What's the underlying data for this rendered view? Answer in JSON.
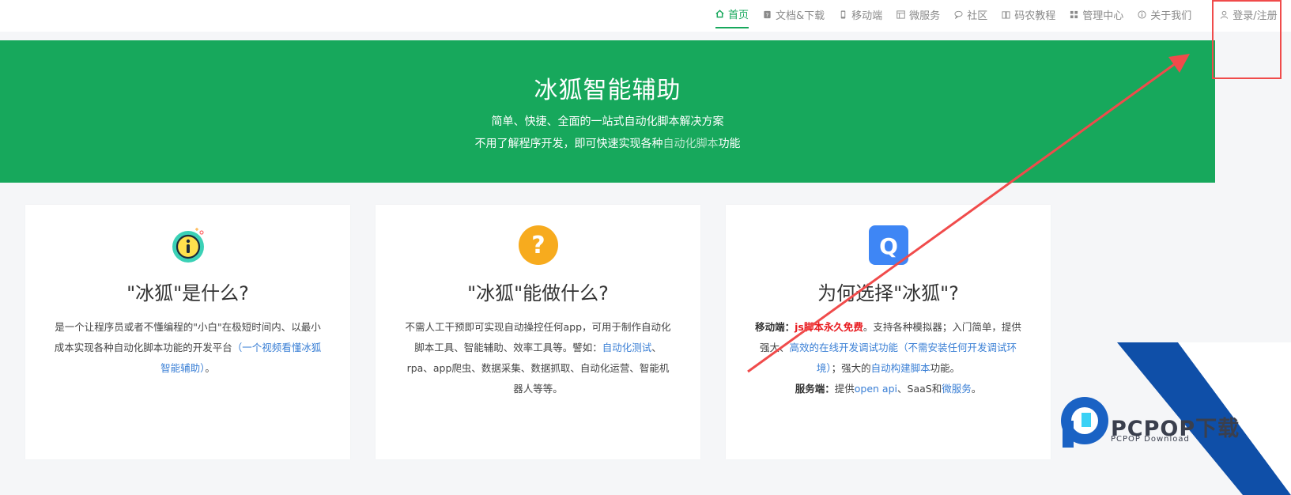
{
  "nav": {
    "items": [
      {
        "label": "首页",
        "icon": "home-icon",
        "active": true
      },
      {
        "label": "文档&下载",
        "icon": "document-icon"
      },
      {
        "label": "移动端",
        "icon": "mobile-icon"
      },
      {
        "label": "微服务",
        "icon": "server-icon"
      },
      {
        "label": "社区",
        "icon": "chat-icon"
      },
      {
        "label": "码农教程",
        "icon": "book-icon"
      },
      {
        "label": "管理中心",
        "icon": "grid-icon"
      },
      {
        "label": "关于我们",
        "icon": "info-icon"
      }
    ],
    "login_label": "登录/注册"
  },
  "hero": {
    "title": "冰狐智能辅助",
    "subtitle1": "简单、快捷、全面的一站式自动化脚本解决方案",
    "subtitle2_prefix": "不用了解程序开发，即可快速实现各种",
    "subtitle2_highlight": "自动化脚本",
    "subtitle2_suffix": "功能"
  },
  "cards": [
    {
      "icon": "info-circle-icon",
      "title": "\"冰狐\"是什么?",
      "desc_part1": "是一个让程序员或者不懂编程的\"小白\"在极短时间内、以最小成本实现各种自动化脚本功能的开发平台",
      "desc_link": "（一个视频看懂冰狐智能辅助）",
      "desc_end": "。"
    },
    {
      "icon": "question-circle-icon",
      "title": "\"冰狐\"能做什么?",
      "desc_part1": "不需人工干预即可实现自动操控任何app，可用于制作自动化脚本工具、智能辅助、效率工具等。譬如：",
      "desc_link": "自动化测试",
      "desc_part2": "、rpa、app爬虫、数据采集、数据抓取、自动化运营、智能机器人等等。"
    },
    {
      "icon": "q-logo-icon",
      "title": "为何选择\"冰狐\"?",
      "mobile_label": "移动端：",
      "mobile_free": "js脚本永久免费",
      "mobile_text1": "。支持各种模拟器；入门简单，提供强大、",
      "mobile_link1": "高效的在线开发调试功能（不需安装任何开发调试环境）",
      "mobile_text2": "；强大的",
      "mobile_link2": "自动构建脚本",
      "mobile_text3": "功能。",
      "server_label": "服务端：",
      "server_text1": "提供",
      "server_link1": "open api",
      "server_text2": "、SaaS和",
      "server_link2": "微服务",
      "server_text3": "。"
    }
  ],
  "watermark": {
    "brand": "PCPOP下载",
    "sub": "PCPOP Download"
  },
  "colors": {
    "brand_green": "#17a85c",
    "link_blue": "#3a7fd5",
    "highlight_red": "#e8191e",
    "annotation_red": "#f04b4b",
    "watermark_blue": "#0f4fa8"
  }
}
